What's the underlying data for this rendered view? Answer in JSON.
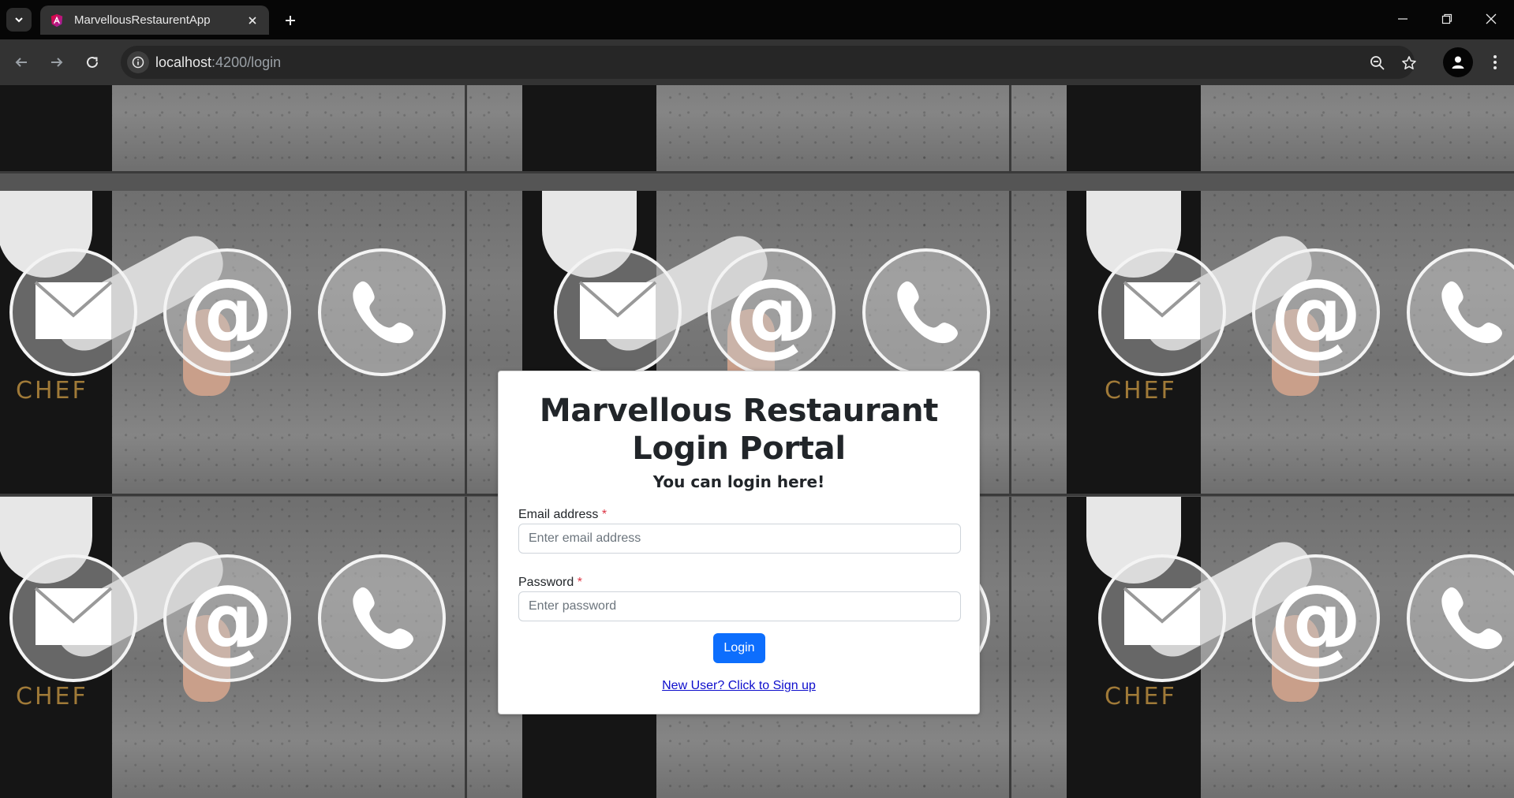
{
  "browser": {
    "tab_title": "MarvellousRestaurentApp",
    "url_host": "localhost",
    "url_path": ":4200/login"
  },
  "background": {
    "apron_text": "CHEF"
  },
  "login": {
    "title": "Marvellous Restaurant Login Portal",
    "subtitle": "You can login here!",
    "email_label": "Email address",
    "email_placeholder": "Enter email address",
    "password_label": "Password",
    "password_placeholder": "Enter password",
    "required_marker": "*",
    "login_button": "Login",
    "signup_link": "New User? Click to Sign up"
  },
  "colors": {
    "primary": "#0d6efd",
    "required": "#dc3545",
    "link": "#0d0dcc"
  }
}
